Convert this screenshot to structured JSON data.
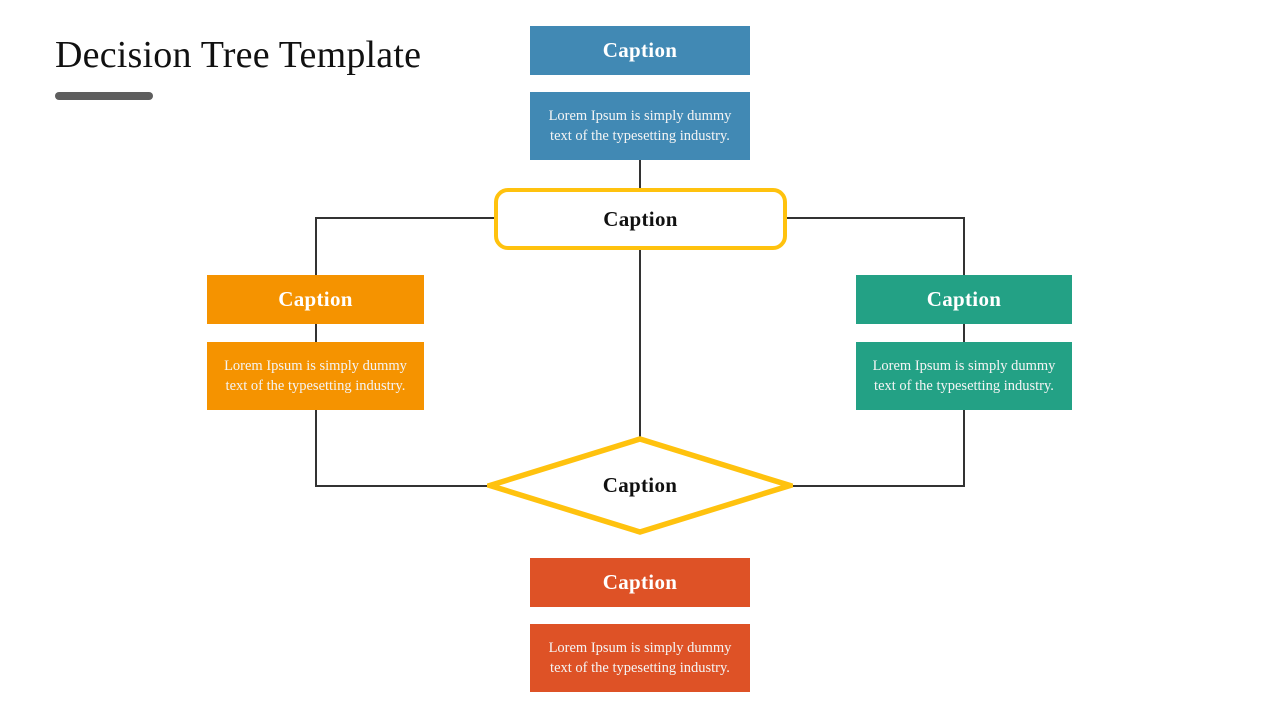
{
  "title": {
    "text": "Decision Tree Template",
    "underline_color": "#5e5e5e"
  },
  "palette": {
    "blue": "#4189b4",
    "orange": "#f59300",
    "teal": "#23a185",
    "red": "#de5226",
    "yellow": "#ffc20e",
    "connector": "#333333",
    "background": "#ffffff"
  },
  "nodes": {
    "top": {
      "caption": "Caption",
      "body": "Lorem Ipsum is simply dummy text of the typesetting industry.",
      "color": "#4189b4"
    },
    "decision_box": {
      "caption": "Caption",
      "color": "#ffc20e"
    },
    "left": {
      "caption": "Caption",
      "body": "Lorem Ipsum is simply dummy text of the typesetting industry.",
      "color": "#f59300"
    },
    "right": {
      "caption": "Caption",
      "body": "Lorem Ipsum is simply dummy text of the typesetting industry.",
      "color": "#23a185"
    },
    "diamond": {
      "caption": "Caption",
      "color": "#ffc20e"
    },
    "bottom": {
      "caption": "Caption",
      "body": "Lorem Ipsum is simply dummy text of the typesetting industry.",
      "color": "#de5226"
    }
  }
}
